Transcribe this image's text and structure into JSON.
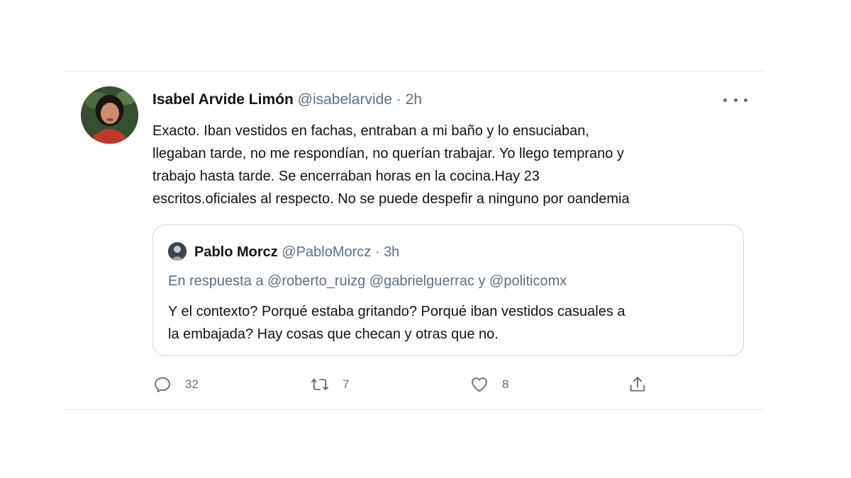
{
  "tweet": {
    "author_name": "Isabel Arvide Limón",
    "author_handle": "@isabelarvide",
    "separator": "·",
    "time": "2h",
    "text_lines": [
      "Exacto. Iban vestidos en fachas, entraban a mi baño y lo ensuciaban,",
      "llegaban tarde, no me respondían, no querían trabajar. Yo llego temprano y",
      "trabajo hasta tarde. Se encerraban horas en la cocina.Hay 23",
      "escritos.oficiales al respecto. No se puede despefir a ninguno por oandemia"
    ],
    "more_icon": "more-horizontal-icon"
  },
  "quoted": {
    "author_name": "Pablo Morcz",
    "author_handle": "@PabloMorcz",
    "separator": "·",
    "time": "3h",
    "reply_context": "En respuesta a @roberto_ruizg @gabrielguerrac y @politicomx",
    "text_lines": [
      "Y el contexto? Porqué estaba gritando? Porqué iban vestidos casuales a",
      "la embajada? Hay cosas que checan y otras que no."
    ]
  },
  "actions": {
    "reply_count": "32",
    "retweet_count": "7",
    "like_count": "8",
    "icons": [
      "reply-icon",
      "retweet-icon",
      "like-icon",
      "share-icon"
    ]
  },
  "colors": {
    "text": "#0f1419",
    "secondary": "#5b7083",
    "border": "#cfd9de",
    "divider": "#e6ecf0"
  }
}
